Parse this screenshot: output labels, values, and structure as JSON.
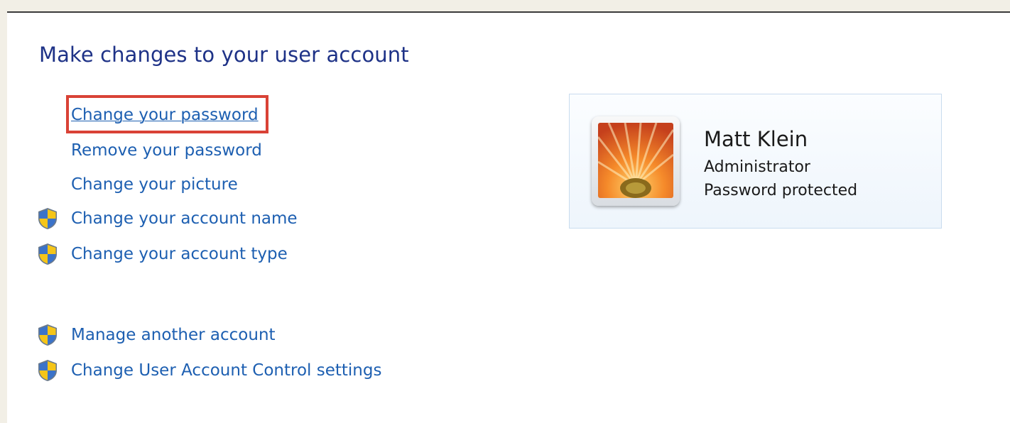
{
  "page": {
    "title": "Make changes to your user account"
  },
  "links": {
    "change_password": "Change your password",
    "remove_password": "Remove your password",
    "change_picture": "Change your picture",
    "change_account_name": "Change your account name",
    "change_account_type": "Change your account type",
    "manage_another_account": "Manage another account",
    "change_uac_settings": "Change User Account Control settings"
  },
  "account": {
    "name": "Matt Klein",
    "type": "Administrator",
    "status": "Password protected"
  },
  "colors": {
    "title": "#1e3287",
    "link": "#1d5fb1",
    "highlight": "#d94236",
    "card_border": "#c9dcee"
  },
  "icons": {
    "uac": "uac-shield-icon"
  }
}
